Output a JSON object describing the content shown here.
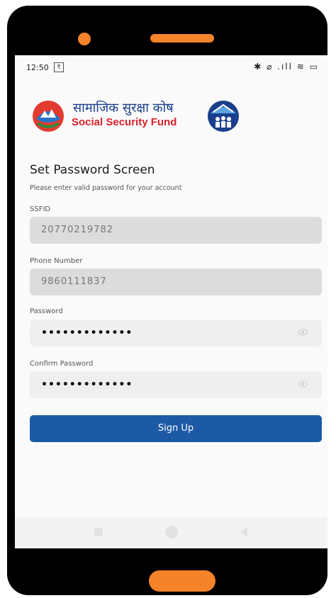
{
  "status_bar": {
    "time": "12:50",
    "notification": "₹",
    "icons": "✱ ⌀ .ıll ≋ ▭"
  },
  "logo": {
    "nepali": "सामाजिक सुरक्षा कोष",
    "english": "Social Security Fund"
  },
  "screen": {
    "title": "Set Password Screen",
    "subtitle": "Please enter valid password for your account"
  },
  "form": {
    "ssfid": {
      "label": "SSFID",
      "value": "20770219782"
    },
    "phone": {
      "label": "Phone Number",
      "value": "9860111837"
    },
    "password": {
      "label": "Password",
      "value": "•••••••••••••"
    },
    "confirm_password": {
      "label": "Confirm Password",
      "value": "•••••••••••••"
    }
  },
  "signup_label": "Sign Up",
  "colors": {
    "accent": "#1d5aa6",
    "phone_accent": "#f5832a",
    "brand_red": "#d8222a",
    "brand_blue": "#1a3f8c"
  },
  "icons": {
    "password_toggle": "eye-icon",
    "nav_home": "circle-icon",
    "nav_recent": "square-icon",
    "nav_back": "back-triangle-icon"
  }
}
